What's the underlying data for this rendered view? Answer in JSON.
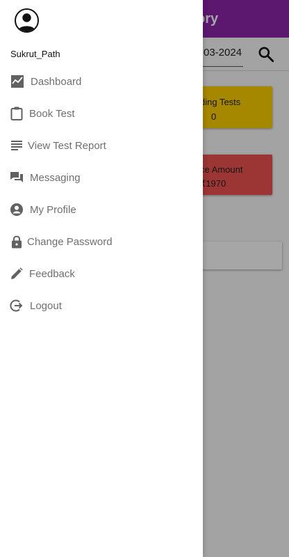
{
  "app": {
    "title_partial": "ory",
    "date_partial": "-03-2024",
    "search_icon": "search-icon",
    "cards": {
      "pending": {
        "title_partial": "ding Tests",
        "value": "0"
      },
      "balance": {
        "title_partial": "ce Amount",
        "value": "₹1970"
      },
      "bottom": {
        "text_partial": ")"
      }
    }
  },
  "drawer": {
    "username": "Sukrut_Path",
    "avatar_icon": "account-circle-icon",
    "items": [
      {
        "label": "Dashboard",
        "icon": "chart-line-icon"
      },
      {
        "label": "Book Test",
        "icon": "clipboard-icon"
      },
      {
        "label": "View Test Report",
        "icon": "list-lines-icon"
      },
      {
        "label": "Messaging",
        "icon": "chat-bubbles-icon"
      },
      {
        "label": "My Profile",
        "icon": "person-circle-icon"
      },
      {
        "label": "Change Password",
        "icon": "lock-icon"
      },
      {
        "label": "Feedback",
        "icon": "pencil-icon"
      },
      {
        "label": "Logout",
        "icon": "logout-icon"
      }
    ]
  },
  "colors": {
    "appbar": "#8e24aa",
    "card_yellow": "#ffcf00",
    "card_red": "#ef5350",
    "menu_text": "#6f6f6f",
    "menu_icon": "#616161"
  }
}
